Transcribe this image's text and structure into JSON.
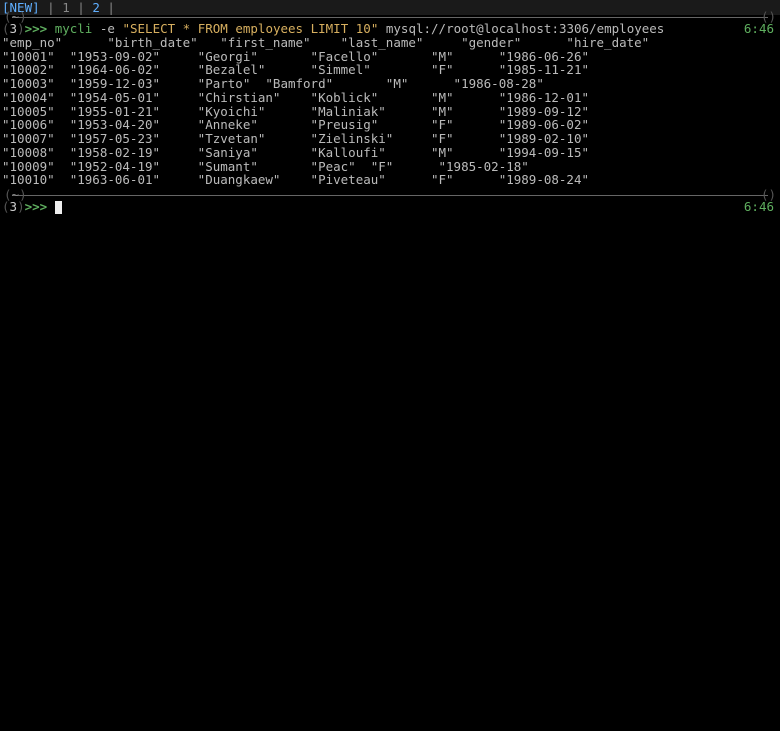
{
  "tabbar": {
    "new_label": "[NEW]",
    "sep": " | ",
    "tab1": "1",
    "tab2": "2"
  },
  "pane1": {
    "meta_left_tilde": "~",
    "prompt_count": "3",
    "prompt_arrows": ">>>",
    "cmd_bin": "mycli",
    "cmd_flag": "-e",
    "cmd_query": "\"SELECT * FROM employees LIMIT 10\"",
    "cmd_conn": "mysql://root@localhost:3306/employees",
    "time": "6:46"
  },
  "output": {
    "header": "\"emp_no\"      \"birth_date\"   \"first_name\"    \"last_name\"     \"gender\"      \"hire_date\"",
    "rows": [
      "\"10001\"  \"1953-09-02\"     \"Georgi\"       \"Facello\"       \"M\"      \"1986-06-26\"",
      "\"10002\"  \"1964-06-02\"     \"Bezalel\"      \"Simmel\"        \"F\"      \"1985-11-21\"",
      "\"10003\"  \"1959-12-03\"     \"Parto\"  \"Bamford\"       \"M\"      \"1986-08-28\"",
      "\"10004\"  \"1954-05-01\"     \"Chirstian\"    \"Koblick\"       \"M\"      \"1986-12-01\"",
      "\"10005\"  \"1955-01-21\"     \"Kyoichi\"      \"Maliniak\"      \"M\"      \"1989-09-12\"",
      "\"10006\"  \"1953-04-20\"     \"Anneke\"       \"Preusig\"       \"F\"      \"1989-06-02\"",
      "\"10007\"  \"1957-05-23\"     \"Tzvetan\"      \"Zielinski\"     \"F\"      \"1989-02-10\"",
      "\"10008\"  \"1958-02-19\"     \"Saniya\"       \"Kalloufi\"      \"M\"      \"1994-09-15\"",
      "\"10009\"  \"1952-04-19\"     \"Sumant\"       \"Peac\"  \"F\"      \"1985-02-18\"",
      "\"10010\"  \"1963-06-01\"     \"Duangkaew\"    \"Piveteau\"      \"F\"      \"1989-08-24\""
    ]
  },
  "pane2": {
    "meta_left_tilde": "~",
    "prompt_count": "3",
    "prompt_arrows": ">>>",
    "time": "6:46"
  }
}
